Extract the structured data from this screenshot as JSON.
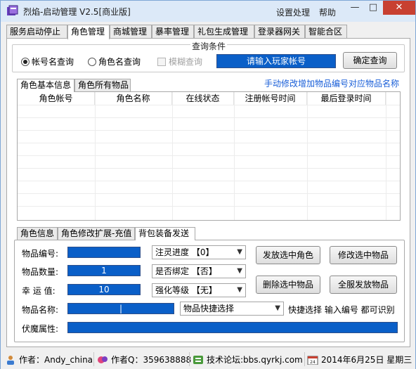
{
  "window": {
    "title": "烈焰-启动管理 V2.5[商业版]",
    "menu": {
      "settings": "设置处理",
      "help": "帮助"
    },
    "controls": {
      "minimize": "—",
      "maximize": "□",
      "close": "✕"
    }
  },
  "main_tabs": [
    "服务启动停止",
    "角色管理",
    "商城管理",
    "暴率管理",
    "礼包生成管理",
    "登录器网关",
    "智能合区"
  ],
  "query": {
    "group_title": "查询条件",
    "radio_account": "帐号名查询",
    "radio_role": "角色名查询",
    "fuzzy": "模糊查询",
    "input_placeholder": "请输入玩家帐号",
    "confirm": "确定查询"
  },
  "hint": "手动修改增加物品编号对应物品名称",
  "info_tabs": [
    "角色基本信息",
    "角色所有物品"
  ],
  "table": {
    "columns": [
      "角色帐号",
      "角色名称",
      "在线状态",
      "注册帐号时间",
      "最后登录时间"
    ]
  },
  "bottom_tabs": [
    "角色信息",
    "角色修改扩展-充值",
    "背包装备发送"
  ],
  "form": {
    "item_id_label": "物品编号:",
    "item_id_value": "",
    "item_qty_label": "物品数量:",
    "item_qty_value": "1",
    "luck_label": "幸 运 值:",
    "luck_value": "10",
    "item_name_label": "物品名称:",
    "item_name_value": "|",
    "attr_label": "伏魔属性:",
    "attr_value": "",
    "soul_select": "注灵进度 【0】",
    "bind_select": "是否绑定 【否】",
    "enhance_select": "强化等级 【无】",
    "quick_select": "物品快捷选择",
    "quick_hint": "快捷选择 输入编号 都可识别",
    "btn_send_role": "发放选中角色",
    "btn_modify_item": "修改选中物品",
    "btn_delete_item": "删除选中物品",
    "btn_send_all": "全服发放物品"
  },
  "status": {
    "author": "作者：Andy_china",
    "qq": "作者Q：359638888",
    "forum": "技术论坛:bbs.qyrkj.com",
    "date": "2014年6月25日 星期三"
  },
  "colors": {
    "accent_blue": "#0a5fc8",
    "close_red": "#c84031",
    "link_blue": "#1a5fd8"
  }
}
